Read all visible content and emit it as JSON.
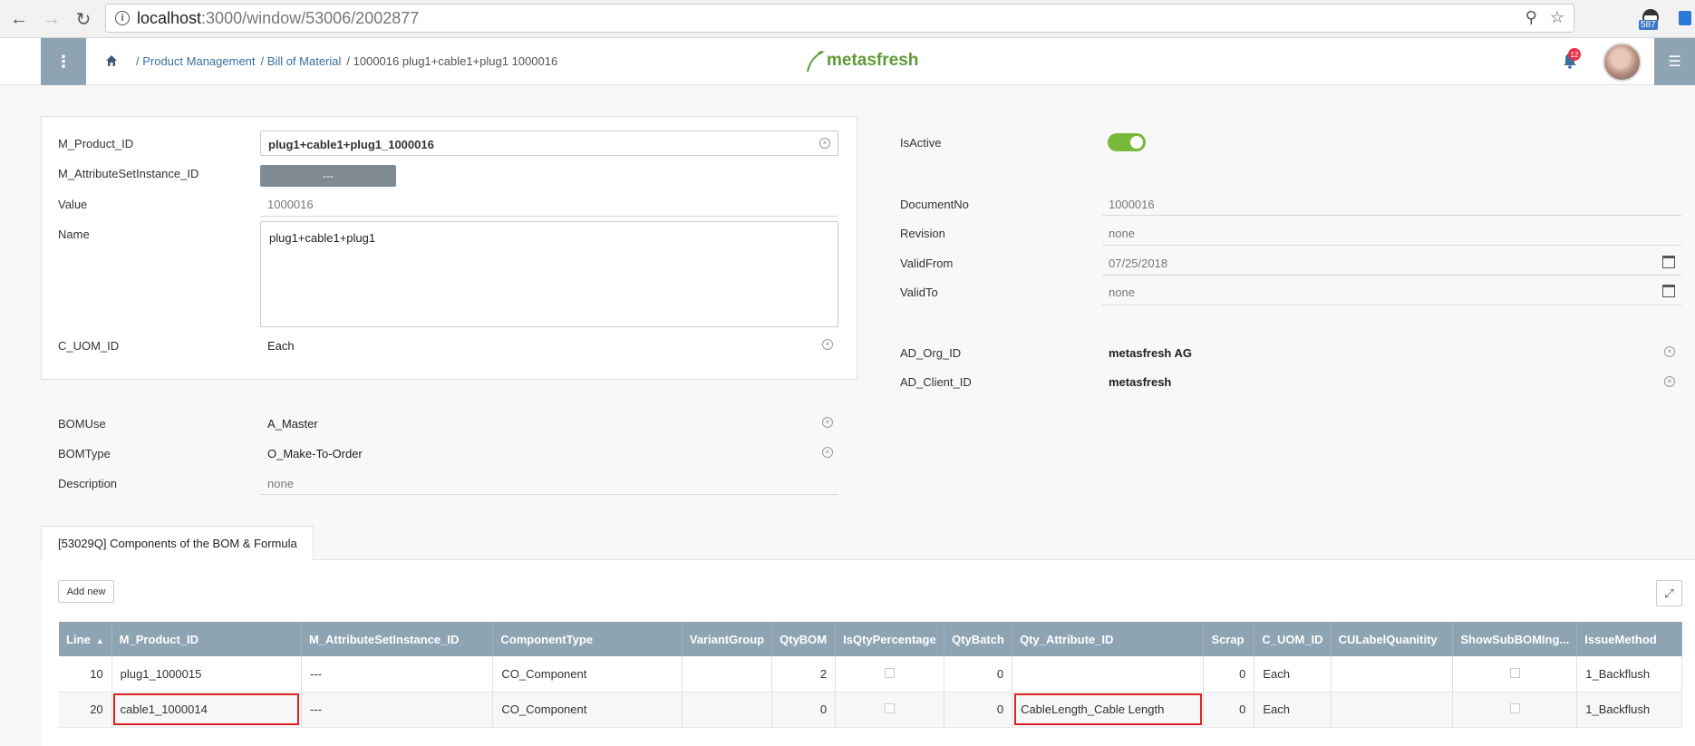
{
  "browser": {
    "url_host": "localhost",
    "url_path": ":3000/window/53006/2002877",
    "ext_badge": "587"
  },
  "header": {
    "breadcrumb": [
      {
        "label": "/ Product Management"
      },
      {
        "label": "/ Bill of Material"
      },
      {
        "label": "/ 1000016 plug1+cable1+plug1 1000016"
      }
    ],
    "logo_text": "metasfresh",
    "notifications_count": "12"
  },
  "form_left": {
    "product_label": "M_Product_ID",
    "product_value": "plug1+cable1+plug1_1000016",
    "asi_label": "M_AttributeSetInstance_ID",
    "asi_value": "---",
    "value_label": "Value",
    "value_value": "1000016",
    "name_label": "Name",
    "name_value": "plug1+cable1+plug1",
    "uom_label": "C_UOM_ID",
    "uom_value": "Each",
    "bomuse_label": "BOMUse",
    "bomuse_value": "A_Master",
    "bomtype_label": "BOMType",
    "bomtype_value": "O_Make-To-Order",
    "description_label": "Description",
    "description_value": "none"
  },
  "form_right": {
    "isactive_label": "IsActive",
    "isactive_on": true,
    "documentno_label": "DocumentNo",
    "documentno_value": "1000016",
    "revision_label": "Revision",
    "revision_value": "none",
    "validfrom_label": "ValidFrom",
    "validfrom_value": "07/25/2018",
    "validto_label": "ValidTo",
    "validto_value": "none",
    "org_label": "AD_Org_ID",
    "org_value": "metasfresh AG",
    "client_label": "AD_Client_ID",
    "client_value": "metasfresh"
  },
  "tab": {
    "label": "[53029Q] Components of the BOM & Formula",
    "add_new_label": "Add new"
  },
  "table": {
    "columns": [
      "Line",
      "M_Product_ID",
      "M_AttributeSetInstance_ID",
      "ComponentType",
      "VariantGroup",
      "QtyBOM",
      "IsQtyPercentage",
      "QtyBatch",
      "Qty_Attribute_ID",
      "Scrap",
      "C_UOM_ID",
      "CULabelQuanitity",
      "ShowSubBOMIng...",
      "IssueMethod"
    ],
    "rows": [
      {
        "line": "10",
        "product": "plug1_1000015",
        "asi": "---",
        "component_type": "CO_Component",
        "variant_group": "",
        "qty_bom": "2",
        "qty_batch": "0",
        "qty_attribute": "",
        "scrap": "0",
        "uom": "Each",
        "cu_label": "",
        "issue_method": "1_Backflush"
      },
      {
        "line": "20",
        "product": "cable1_1000014",
        "asi": "---",
        "component_type": "CO_Component",
        "variant_group": "",
        "qty_bom": "0",
        "qty_batch": "0",
        "qty_attribute": "CableLength_Cable Length",
        "scrap": "0",
        "uom": "Each",
        "cu_label": "",
        "issue_method": "1_Backflush"
      }
    ]
  }
}
